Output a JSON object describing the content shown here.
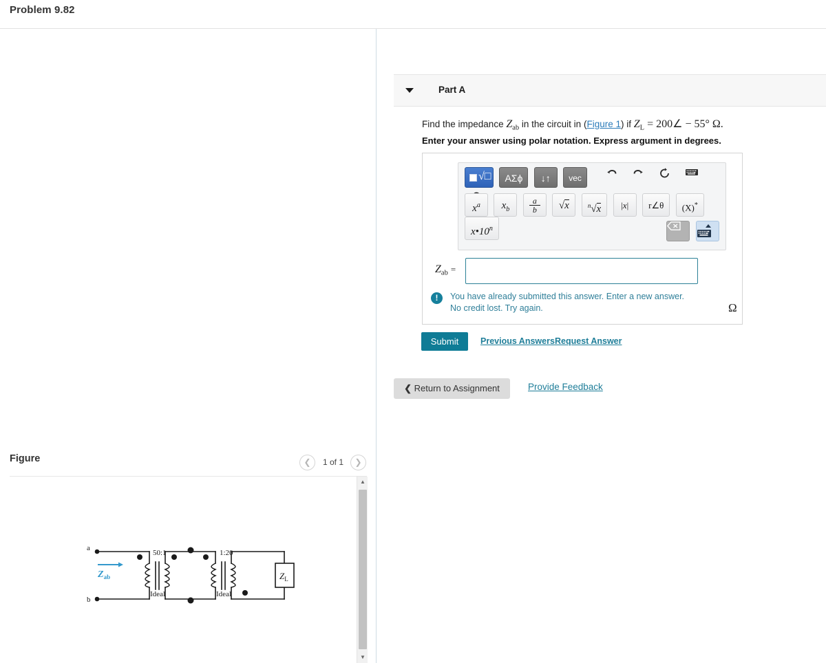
{
  "header": {
    "problem_title": "Problem 9.82"
  },
  "part": {
    "caret_icon": "caret-down-icon",
    "label": "Part A"
  },
  "question": {
    "text_before_var": "Find the impedance ",
    "var_z": "Z",
    "var_z_sub": "ab",
    "text_mid": " in the circuit in ",
    "figure_link": "Figure 1",
    "text_if": " if ",
    "zl_var": "Z",
    "zl_sub": "L",
    "zl_value": " = 200∠ − 55° Ω.",
    "instruction": "Enter your answer using polar notation. Express argument in degrees."
  },
  "mathbar": {
    "mode_buttons": [
      {
        "name": "template-mode-button",
        "label": "",
        "icon": "square-root-template-icon",
        "active": true
      },
      {
        "name": "greek-symbols-button",
        "label": "ΑΣϕ",
        "active": false
      },
      {
        "name": "arrows-button",
        "label": "↓↑",
        "active": false
      },
      {
        "name": "vector-button",
        "label": "vec",
        "active": false
      }
    ],
    "tool_icons": [
      {
        "name": "undo-icon",
        "glyph": "↶"
      },
      {
        "name": "redo-icon",
        "glyph": "↷"
      },
      {
        "name": "reset-icon",
        "glyph": "↻"
      },
      {
        "name": "keyboard-icon",
        "glyph": "⌨"
      },
      {
        "name": "help-icon",
        "glyph": "?"
      }
    ],
    "keys": [
      {
        "name": "power-key",
        "label": "xᵃ"
      },
      {
        "name": "subscript-key",
        "label": "xₑ"
      },
      {
        "name": "fraction-key",
        "label": "a/b"
      },
      {
        "name": "sqrt-key",
        "label": "√x"
      },
      {
        "name": "nth-root-key",
        "label": "ⁿ√x"
      },
      {
        "name": "absolute-value-key",
        "label": "|x|"
      },
      {
        "name": "polar-key",
        "label": "r∠θ"
      },
      {
        "name": "conjugate-key",
        "label": "(X)*"
      },
      {
        "name": "scientific-notation-key",
        "label": "x•10ⁿ"
      }
    ],
    "backspace_icon": "backspace-icon",
    "keyboard_toggle_icon": "onscreen-keyboard-icon"
  },
  "answer": {
    "var_label": "Z",
    "var_sub": "ab",
    "equals": "=",
    "value": "",
    "placeholder": "",
    "unit": "Ω"
  },
  "feedback": {
    "icon": "exclamation-circle-icon",
    "line1": "You have already submitted this answer. Enter a new answer.",
    "line2": "No credit lost. Try again."
  },
  "actions": {
    "submit_label": "Submit",
    "previous_answers_label": "Previous Answers",
    "request_answer_label": "Request Answer",
    "return_icon": "chevron-left-icon",
    "return_label": "Return to Assignment",
    "provide_feedback_label": "Provide Feedback"
  },
  "figure": {
    "title": "Figure",
    "prev_icon": "chevron-left-icon",
    "next_icon": "chevron-right-icon",
    "pagination": "1 of 1",
    "scrollbar": {
      "up_icon": "triangle-up-icon",
      "down_icon": "triangle-down-icon"
    },
    "circuit": {
      "terminal_a": "a",
      "terminal_b": "b",
      "input_impedance": "Z",
      "input_impedance_sub": "ab",
      "transformer1_ratio": "50:1",
      "transformer1_label": "Ideal",
      "transformer2_ratio": "1:20",
      "transformer2_label": "Ideal",
      "load_label": "Z",
      "load_sub": "L"
    }
  },
  "colors": {
    "accent_teal": "#0f7c96",
    "link_blue": "#1f7e99",
    "figure_link": "#2b7bb9",
    "zab_blue": "#3399cc",
    "divider": "#cfdce3",
    "panel_bg": "#f7f7f7"
  }
}
